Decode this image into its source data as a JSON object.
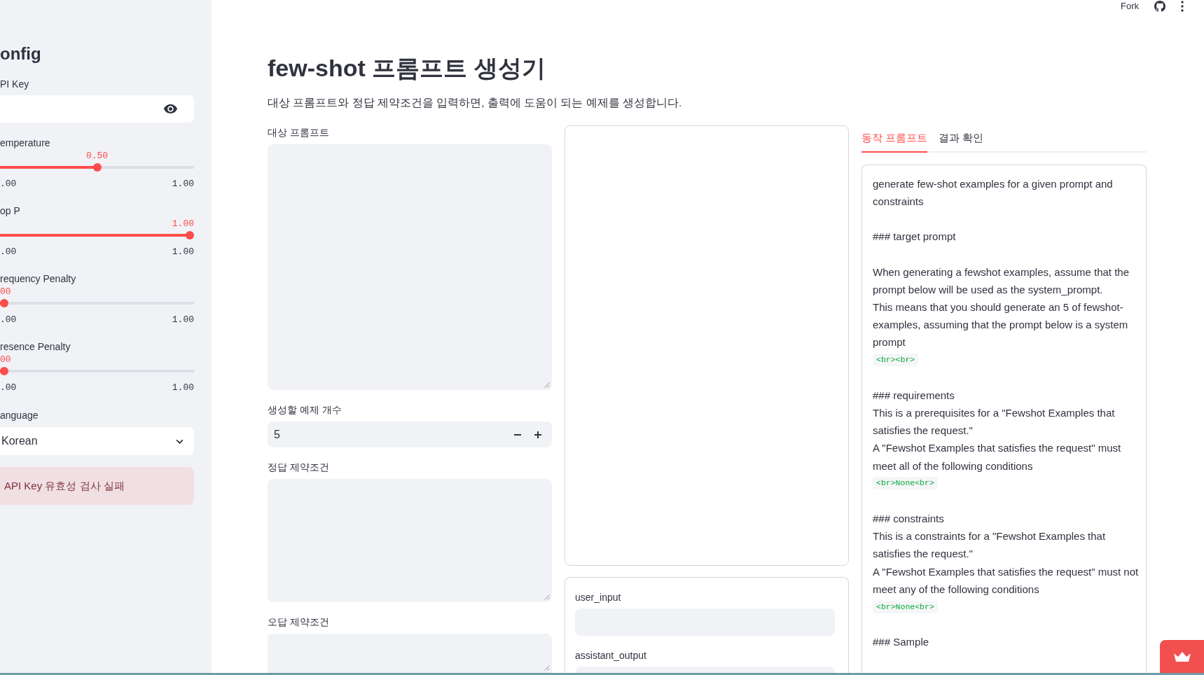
{
  "header": {
    "fork_label": "Fork"
  },
  "sidebar": {
    "title": "onfig",
    "api_key": {
      "label": "PI Key"
    },
    "sliders": [
      {
        "label": "emperature",
        "value": "0.50",
        "level": 0.5,
        "min": ".00",
        "max": "1.00"
      },
      {
        "label": "op P",
        "value": "1.00",
        "level": 1,
        "min": ".00",
        "max": "1.00"
      },
      {
        "label": "requency Penalty",
        "value": "00",
        "level": 0,
        "min": ".00",
        "max": "1.00"
      },
      {
        "label": "resence Penalty",
        "value": "00",
        "level": 0,
        "min": ".00",
        "max": "1.00"
      }
    ],
    "language": {
      "label": "anguage",
      "value": "Korean"
    },
    "alert": {
      "kind": "error",
      "text": "API Key 유효성 검사 실패"
    }
  },
  "main": {
    "title": "few-shot 프롬프트 생성기",
    "subtitle": "대상 프롬프트와 정답 제약조건을 입력하면, 출력에 도움이 되는 예제를 생성합니다.",
    "inputs": [
      {
        "kind": "textarea",
        "label": "대상 프롬프트"
      },
      {
        "kind": "number",
        "label": "생성할 예제 개수",
        "value": "5"
      },
      {
        "kind": "textarea",
        "label": "정답 제약조건"
      },
      {
        "kind": "textarea",
        "label": "오답 제약조건"
      }
    ],
    "form_fields": [
      {
        "label": "user_input"
      },
      {
        "label": "assistant_output"
      }
    ],
    "tabs": [
      {
        "label": "동작 프롬프트",
        "selected": true
      },
      {
        "label": "결과 확인",
        "selected": false
      }
    ],
    "prompt_paragraphs": [
      {
        "lines": [
          {
            "kind": "text",
            "text": "generate few-shot examples for a given prompt and constraints"
          }
        ]
      },
      {
        "lines": [
          {
            "kind": "text",
            "text": "### target prompt"
          }
        ]
      },
      {
        "lines": [
          {
            "kind": "text",
            "text": "When generating a fewshot examples, assume that the prompt below will be used as the system_prompt."
          },
          {
            "kind": "text",
            "text": "This means that you should generate an 5 of fewshot-examples, assuming that the prompt below is a system prompt"
          },
          {
            "kind": "code",
            "text": "<br><br>"
          }
        ]
      },
      {
        "lines": [
          {
            "kind": "text",
            "text": "### requirements"
          },
          {
            "kind": "text",
            "text": "This is a prerequisites for a \"Fewshot Examples that satisfies the request.\""
          },
          {
            "kind": "text",
            "text": "A \"Fewshot Examples that satisfies the request\" must meet all of the following conditions"
          },
          {
            "kind": "code",
            "text": "<br>None<br>"
          }
        ]
      },
      {
        "lines": [
          {
            "kind": "text",
            "text": "### constraints"
          },
          {
            "kind": "text",
            "text": "This is a constraints for a \"Fewshot Examples that satisfies the request.\""
          },
          {
            "kind": "text",
            "text": "A \"Fewshot Examples that satisfies the request\" must not meet any of the following conditions"
          },
          {
            "kind": "code",
            "text": "<br>None<br>"
          }
        ]
      },
      {
        "lines": [
          {
            "kind": "text",
            "text": "### Sample"
          }
        ]
      }
    ]
  }
}
